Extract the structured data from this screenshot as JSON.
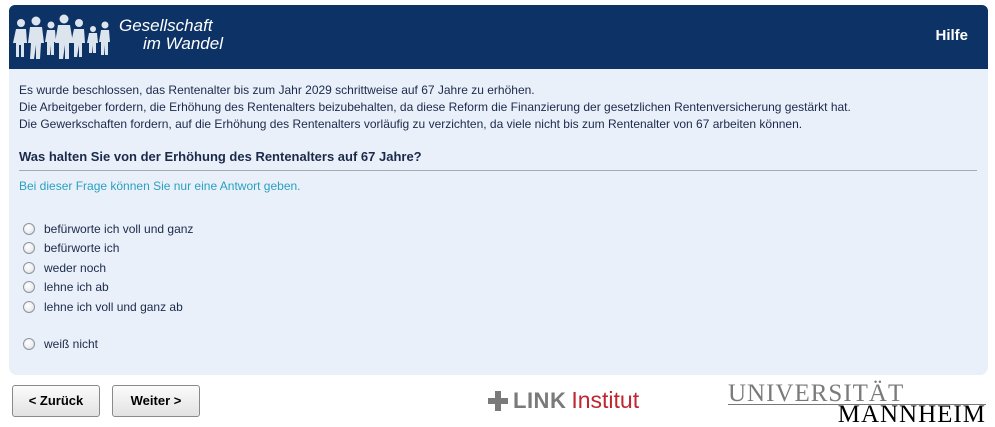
{
  "header": {
    "logo_line1": "Gesellschaft",
    "logo_line2": "im Wandel",
    "help_label": "Hilfe"
  },
  "intro": [
    "Es wurde beschlossen, das Rentenalter bis zum Jahr 2029 schrittweise auf 67 Jahre zu erhöhen.",
    "Die Arbeitgeber fordern, die Erhöhung des Rentenalters beizubehalten, da diese Reform die Finanzierung der gesetzlichen Rentenversicherung gestärkt hat.",
    "Die Gewerkschaften fordern, auf die Erhöhung des Rentenalters vorläufig zu verzichten, da viele nicht bis zum Rentenalter von 67 arbeiten können."
  ],
  "question": "Was halten Sie von der Erhöhung des Rentenalters auf 67 Jahre?",
  "hint": "Bei dieser Frage können Sie nur eine Antwort geben.",
  "options": [
    "befürworte ich voll und ganz",
    "befürworte ich",
    "weder noch",
    "lehne ich ab",
    "lehne ich voll und ganz ab",
    "weiß nicht"
  ],
  "nav": {
    "back_label": "< Zurück",
    "next_label": "Weiter >"
  },
  "logos": {
    "link_word": "LINK",
    "link_institut": "Institut",
    "uni_line1": "UNIVERSITÄT",
    "uni_line2": "MANNHEIM"
  },
  "colors": {
    "header_bg": "#0c3266",
    "panel_bg": "#e9f0fa",
    "hint_color": "#2aa0c0",
    "link_red": "#c0262f"
  }
}
